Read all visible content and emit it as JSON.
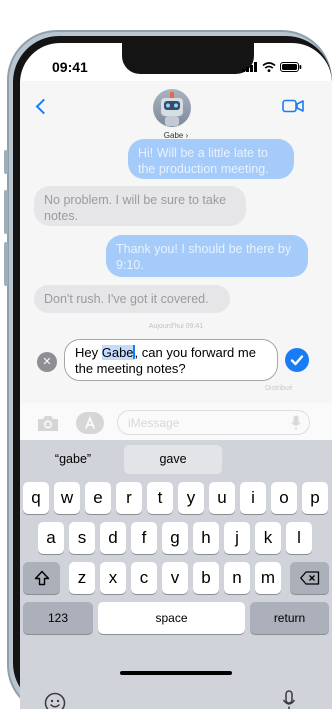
{
  "status": {
    "time": "09:41"
  },
  "contact": {
    "name": "Gabe ›"
  },
  "messages": [
    {
      "dir": "out",
      "text": "Hi! Will be a little late to the production meeting."
    },
    {
      "dir": "in",
      "text": "No problem. I will be sure to take notes."
    },
    {
      "dir": "out",
      "text": "Thank you! I should be there by 9:10."
    },
    {
      "dir": "in",
      "text": "Don't rush. I've got it covered."
    }
  ],
  "timestamp": "Aujourd'hui 09:41",
  "edit": {
    "before": "Hey ",
    "selected": "Gabe",
    "after": ", can you forward me the meeting notes?"
  },
  "delivered": "Distribué",
  "compose": {
    "placeholder": "iMessage"
  },
  "suggestions": [
    "“gabe”",
    "gave",
    ""
  ],
  "keyboard": {
    "row1": [
      "q",
      "w",
      "e",
      "r",
      "t",
      "y",
      "u",
      "i",
      "o",
      "p"
    ],
    "row2": [
      "a",
      "s",
      "d",
      "f",
      "g",
      "h",
      "j",
      "k",
      "l"
    ],
    "row3": [
      "z",
      "x",
      "c",
      "v",
      "b",
      "n",
      "m"
    ],
    "numbers": "123",
    "space": "space",
    "return": "return"
  },
  "colors": {
    "accent": "#1a7cf5",
    "outgoing_bubble": "#a4cbf9",
    "incoming_bubble": "#e6e6e8",
    "keyboard_bg": "#d0d3d9"
  },
  "icons": [
    "back-chevron-icon",
    "video-call-icon",
    "camera-icon",
    "app-store-icon",
    "microphone-icon",
    "shift-icon",
    "backspace-icon",
    "emoji-icon",
    "dictation-icon",
    "checkmark-icon",
    "close-icon"
  ]
}
